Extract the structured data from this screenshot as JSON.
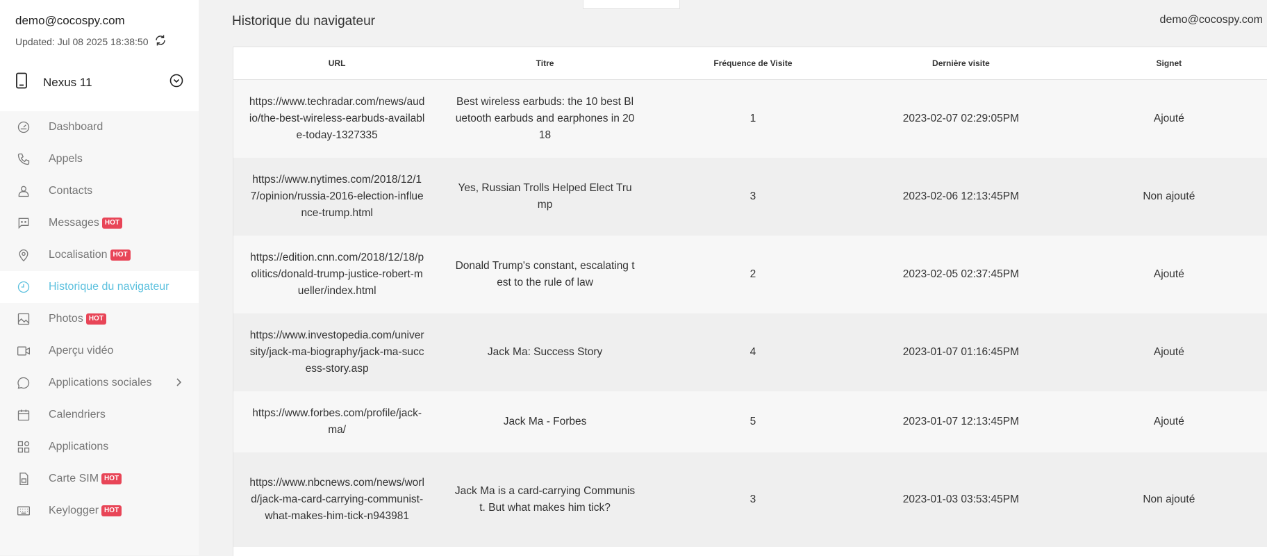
{
  "account": {
    "email": "demo@cocospy.com",
    "updated": "Updated: Jul 08 2025 18:38:50"
  },
  "device": {
    "name": "Nexus 11"
  },
  "menu": [
    {
      "label": "Dashboard",
      "icon": "dashboard-icon",
      "hot": false,
      "active": false
    },
    {
      "label": "Appels",
      "icon": "phone-icon",
      "hot": false,
      "active": false
    },
    {
      "label": "Contacts",
      "icon": "person-icon",
      "hot": false,
      "active": false
    },
    {
      "label": "Messages",
      "icon": "message-icon",
      "hot": true,
      "active": false
    },
    {
      "label": "Localisation",
      "icon": "location-icon",
      "hot": true,
      "active": false
    },
    {
      "label": "Historique du navigateur",
      "icon": "clock-icon",
      "hot": false,
      "active": true
    },
    {
      "label": "Photos",
      "icon": "image-icon",
      "hot": true,
      "active": false
    },
    {
      "label": "Aperçu vidéo",
      "icon": "video-icon",
      "hot": false,
      "active": false
    },
    {
      "label": "Applications sociales",
      "icon": "chat-icon",
      "hot": false,
      "active": false,
      "submenu": true
    },
    {
      "label": "Calendriers",
      "icon": "calendar-icon",
      "hot": false,
      "active": false
    },
    {
      "label": "Applications",
      "icon": "apps-icon",
      "hot": false,
      "active": false
    },
    {
      "label": "Carte SIM",
      "icon": "sim-icon",
      "hot": true,
      "active": false
    },
    {
      "label": "Keylogger",
      "icon": "keyboard-icon",
      "hot": true,
      "active": false
    }
  ],
  "hot_label": "HOT",
  "header": {
    "title": "Historique du navigateur",
    "email": "demo@cocospy.com"
  },
  "table": {
    "columns": [
      "URL",
      "Titre",
      "Fréquence de Visite",
      "Dernière visite",
      "Signet"
    ],
    "rows": [
      {
        "url": "https://www.techradar.com/news/audio/the-best-wireless-earbuds-available-today-1327335",
        "title": "Best wireless earbuds: the 10 best Bluetooth earbuds and earphones in 2018",
        "freq": "1",
        "last": "2023-02-07 02:29:05PM",
        "bookmark": "Ajouté"
      },
      {
        "url": "https://www.nytimes.com/2018/12/17/opinion/russia-2016-election-influence-trump.html",
        "title": "Yes, Russian Trolls Helped Elect Trump",
        "freq": "3",
        "last": "2023-02-06 12:13:45PM",
        "bookmark": "Non ajouté"
      },
      {
        "url": "https://edition.cnn.com/2018/12/18/politics/donald-trump-justice-robert-mueller/index.html",
        "title": "Donald Trump's constant, escalating test to the rule of law",
        "freq": "2",
        "last": "2023-02-05 02:37:45PM",
        "bookmark": "Ajouté"
      },
      {
        "url": "https://www.investopedia.com/university/jack-ma-biography/jack-ma-success-story.asp",
        "title": "Jack Ma: Success Story",
        "freq": "4",
        "last": "2023-01-07 01:16:45PM",
        "bookmark": "Ajouté"
      },
      {
        "url": "https://www.forbes.com/profile/jack-ma/",
        "title": "Jack Ma - Forbes",
        "freq": "5",
        "last": "2023-01-07 12:13:45PM",
        "bookmark": "Ajouté"
      },
      {
        "url": "https://www.nbcnews.com/news/world/jack-ma-card-carrying-communist-what-makes-him-tick-n943981",
        "title": "Jack Ma is a card-carrying Communist. But what makes him tick?",
        "freq": "3",
        "last": "2023-01-03 03:53:45PM",
        "bookmark": "Non ajouté"
      }
    ]
  },
  "colors": {
    "accent": "#5bc0de",
    "hot": "#e84557"
  }
}
